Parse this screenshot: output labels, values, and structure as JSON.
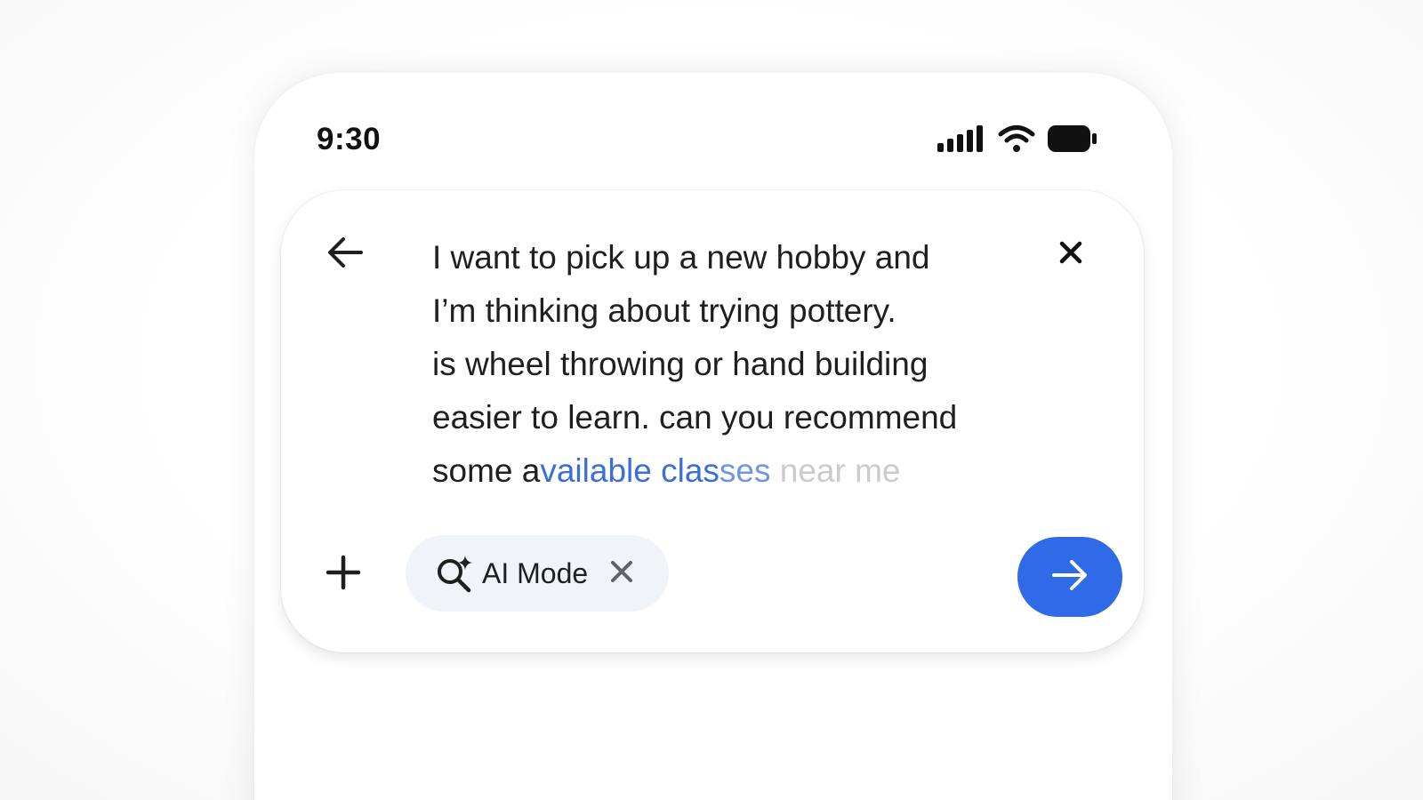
{
  "status_bar": {
    "time": "9:30",
    "icons": [
      "cellular-signal-icon",
      "wifi-icon",
      "battery-icon"
    ]
  },
  "search": {
    "query_lines": [
      "I want to pick up a new hobby and",
      "I’m thinking about trying pottery.",
      "is wheel throwing or hand building",
      "easier to learn. can you recommend"
    ],
    "last_line": {
      "solid": "some a",
      "blue_strong": "vailable clas",
      "blue_soft": "ses",
      "grey": " near me"
    },
    "back_icon": "arrow-left-icon",
    "clear_icon": "close-icon"
  },
  "toolbar": {
    "add_icon": "plus-icon",
    "mode_chip": {
      "label": "AI Mode",
      "icon": "search-sparkle-icon",
      "remove_icon": "close-icon"
    },
    "send_icon": "arrow-right-icon"
  },
  "colors": {
    "accent_blue": "#2f6be6",
    "text": "#1f1f1f",
    "chip_bg": "#f0f3f7",
    "typing_blue": "#3b6fd6",
    "typing_grey": "#c9cbd0"
  }
}
